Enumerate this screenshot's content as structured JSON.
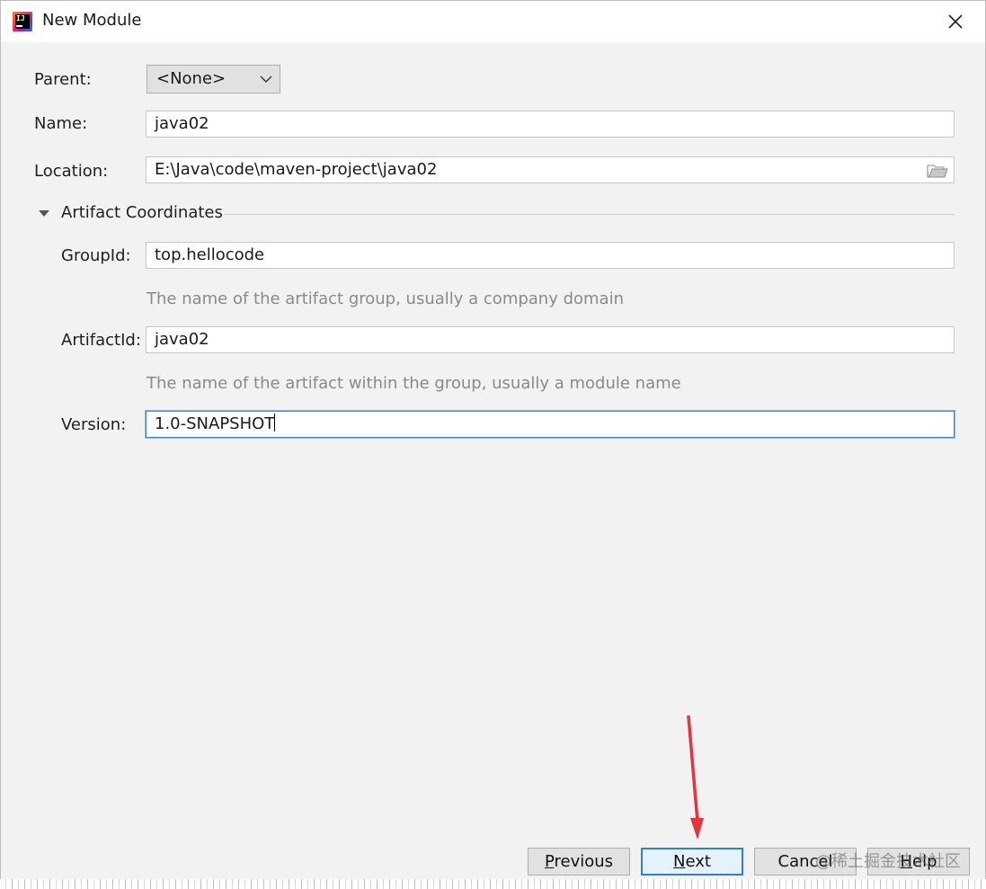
{
  "dialog": {
    "title": "New Module",
    "icons": {
      "app": "intellij-idea-icon",
      "close": "close-icon"
    }
  },
  "form": {
    "parent": {
      "label": "Parent:",
      "value": "<None>"
    },
    "name": {
      "label": "Name:",
      "value": "java02"
    },
    "location": {
      "label": "Location:",
      "value": "E:\\Java\\code\\maven-project\\java02"
    }
  },
  "artifact_section": {
    "title": "Artifact Coordinates",
    "expanded": true,
    "group_id": {
      "label": "GroupId:",
      "value": "top.hellocode",
      "hint": "The name of the artifact group, usually a company domain"
    },
    "artifact_id": {
      "label": "ArtifactId:",
      "value": "java02",
      "hint": "The name of the artifact within the group, usually a module name"
    },
    "version": {
      "label": "Version:",
      "value": "1.0-SNAPSHOT",
      "focused": true
    }
  },
  "buttons": {
    "previous": {
      "mnemonic": "P",
      "rest": "revious"
    },
    "next": {
      "mnemonic": "N",
      "rest": "ext"
    },
    "cancel": {
      "label": "Cancel"
    },
    "help": {
      "mnemonic": "H",
      "rest": "elp"
    }
  },
  "watermark": "@稀土掘金技术社区",
  "colors": {
    "focus": "#3f87d6",
    "annotation_arrow": "#e8323c"
  }
}
